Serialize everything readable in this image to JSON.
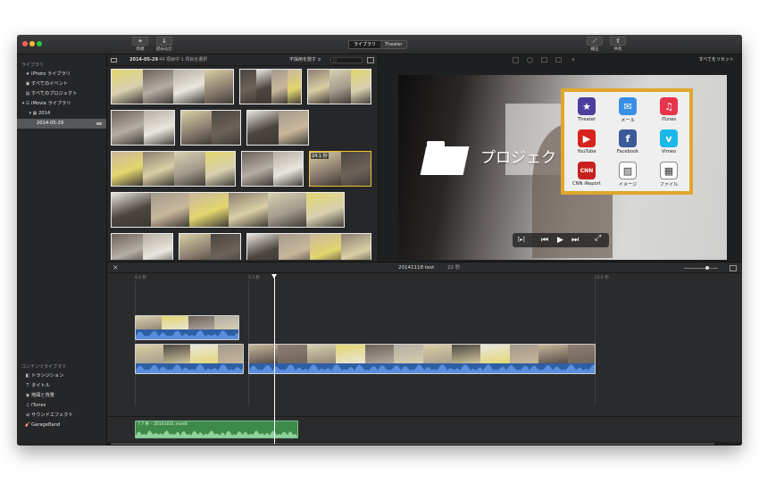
{
  "toolbar": {
    "new_label": "新規",
    "import_label": "読み込む",
    "tab_library": "ライブラリ",
    "tab_theater": "Theater",
    "adjust_label": "補正",
    "share_label": "共有"
  },
  "sidebar": {
    "library_header": "ライブラリ",
    "items": [
      {
        "icon": "★",
        "label": "iPhoto ライブラリ"
      },
      {
        "icon": "▣",
        "label": "すべてのイベント"
      },
      {
        "icon": "▤",
        "label": "すべてのプロジェクト"
      },
      {
        "icon": "▾ ☷",
        "label": "iMovie ライブラリ"
      },
      {
        "icon": "▾ ▦",
        "label": "2014"
      },
      {
        "icon": "",
        "label": "2014-05-29"
      }
    ],
    "content_header": "コンテンツライブラリ",
    "content_items": [
      {
        "icon": "◧",
        "label": "トランジション"
      },
      {
        "icon": "T",
        "label": "タイトル"
      },
      {
        "icon": "◉",
        "label": "地図と背景"
      },
      {
        "icon": "♫",
        "label": "iTunes"
      },
      {
        "icon": "◂)",
        "label": "サウンドエフェクト"
      },
      {
        "icon": "🎸",
        "label": "GarageBand"
      }
    ]
  },
  "browser": {
    "date": "2014-05-29",
    "count": "44 項目中 1 項目を選択",
    "filter": "不採用を隠す ≎",
    "duration_badge": "24.1 秒"
  },
  "viewer": {
    "reset_label": "すべてをリセット",
    "overlay_title": "プロジェクト名を決める",
    "fullscreen_icon": "⤢"
  },
  "share_menu": {
    "items": [
      {
        "label": "Theater",
        "glyph": "★",
        "color": "#4b3f9e"
      },
      {
        "label": "メール",
        "glyph": "✉",
        "color": "#3a8ee6"
      },
      {
        "label": "iTunes",
        "glyph": "♫",
        "color": "#e6344a"
      },
      {
        "label": "YouTube",
        "glyph": "▶",
        "color": "#d8231c"
      },
      {
        "label": "Facebook",
        "glyph": "f",
        "color": "#3b5a99"
      },
      {
        "label": "Vimeo",
        "glyph": "v",
        "color": "#1ab7ea"
      },
      {
        "label": "CNN iReport",
        "glyph": "CNN",
        "color": "#c8201e"
      },
      {
        "label": "イメージ",
        "glyph": "▨",
        "color": "#ffffff"
      },
      {
        "label": "ファイル",
        "glyph": "▦",
        "color": "#ffffff"
      }
    ]
  },
  "timeline": {
    "title": "20141118 test",
    "duration": "22 秒",
    "ruler": [
      "0.0 秒",
      "5.3 秒",
      "22.6 秒"
    ],
    "audio_clip_label": "7.7 秒 – 20141031 montt"
  }
}
